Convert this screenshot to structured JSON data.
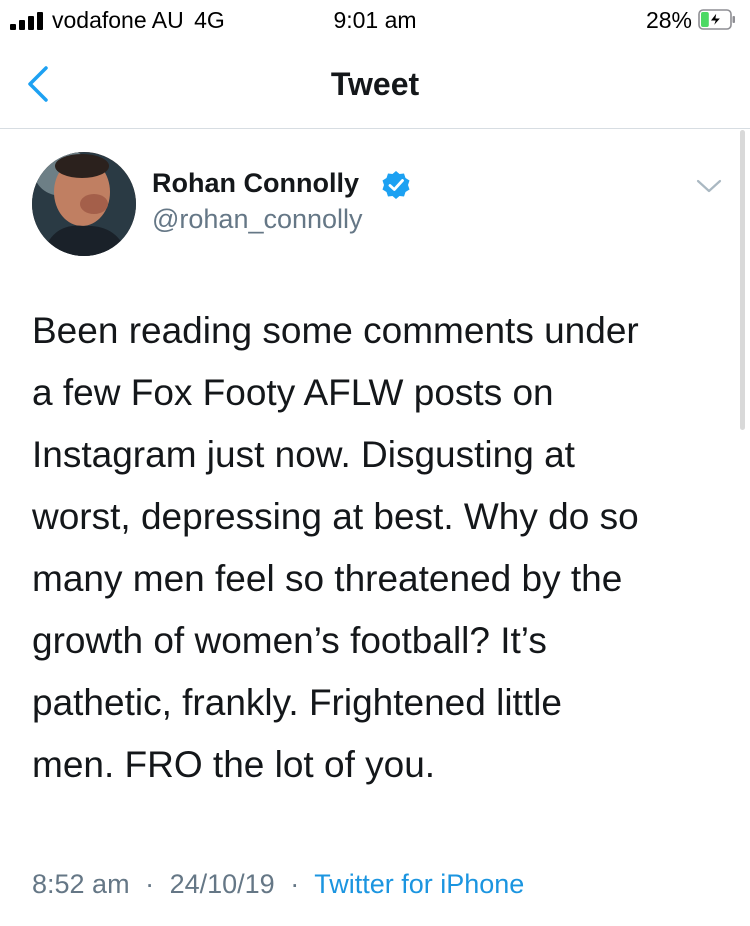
{
  "status_bar": {
    "carrier": "vodafone AU",
    "network": "4G",
    "time": "9:01 am",
    "battery_percent": "28%",
    "battery_level": 0.28,
    "charging": true
  },
  "nav": {
    "title": "Tweet",
    "back_icon": "chevron-left-icon"
  },
  "tweet": {
    "author_name": "Rohan Connolly",
    "author_handle": "@rohan_connolly",
    "verified": true,
    "text_lines": [
      "Been reading some comments under",
      "a few Fox Footy AFLW posts on",
      "Instagram just now. Disgusting at",
      "worst, depressing at best. Why do so",
      "many men feel so threatened by the",
      "growth of women’s football? It’s",
      "pathetic, frankly. Frightened little",
      "men. FRO the lot of you."
    ],
    "time": "8:52 am",
    "date": "24/10/19",
    "source": "Twitter for iPhone",
    "separator": "·"
  },
  "colors": {
    "accent": "#1da1f2",
    "link": "#1b95e0",
    "secondary_text": "#657786",
    "primary_text": "#14171a",
    "battery_charging": "#4cd964"
  }
}
